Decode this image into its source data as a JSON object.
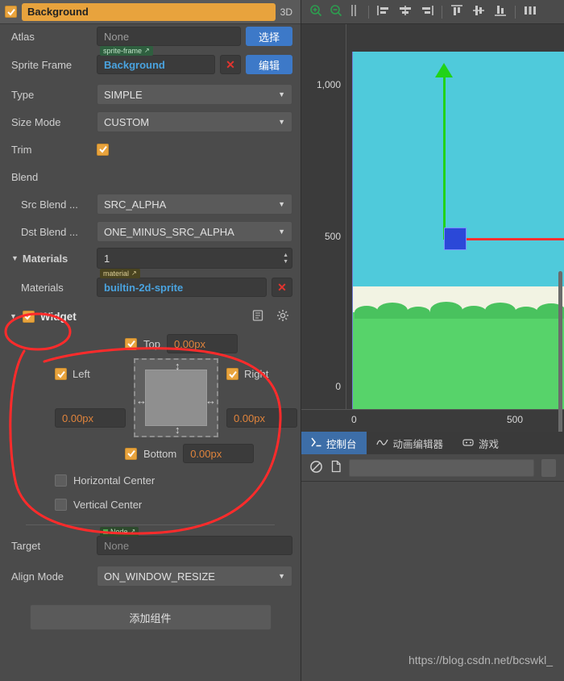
{
  "inspector": {
    "node_enabled": true,
    "node_name": "Background",
    "mode_3d": "3D",
    "properties": [
      {
        "label": "Atlas",
        "type": "asset-select",
        "value": "None",
        "button": "选择"
      },
      {
        "label": "Sprite Frame",
        "type": "asset",
        "tag": "sprite-frame",
        "value": "Background",
        "button": "编辑"
      },
      {
        "label": "Type",
        "type": "select",
        "value": "SIMPLE"
      },
      {
        "label": "Size Mode",
        "type": "select",
        "value": "CUSTOM"
      },
      {
        "label": "Trim",
        "type": "checkbox",
        "checked": true
      },
      {
        "label": "Blend",
        "type": "header"
      },
      {
        "label": "Src Blend ...",
        "type": "select",
        "value": "SRC_ALPHA"
      },
      {
        "label": "Dst Blend ...",
        "type": "select",
        "value": "ONE_MINUS_SRC_ALPHA"
      }
    ],
    "materials": {
      "section_label": "Materials",
      "count": "1",
      "row_label": "Materials",
      "tag": "material",
      "value": "builtin-2d-sprite"
    },
    "widget": {
      "enabled": true,
      "title": "Widget",
      "top": {
        "label": "Top",
        "checked": true,
        "value": "0.00px"
      },
      "left": {
        "label": "Left",
        "checked": true,
        "value": "0.00px"
      },
      "right": {
        "label": "Right",
        "checked": true,
        "value": "0.00px"
      },
      "bottom": {
        "label": "Bottom",
        "checked": true,
        "value": "0.00px"
      },
      "horizontal_center": {
        "label": "Horizontal Center",
        "checked": false
      },
      "vertical_center": {
        "label": "Vertical Center",
        "checked": false
      },
      "target": {
        "label": "Target",
        "tag": "Node",
        "value": "None"
      },
      "align_mode": {
        "label": "Align Mode",
        "value": "ON_WINDOW_RESIZE"
      }
    },
    "add_component_button": "添加组件"
  },
  "scene": {
    "rulers": {
      "left": [
        "1,000",
        "500",
        "0"
      ],
      "bottom": [
        "0",
        "500"
      ]
    }
  },
  "bottom_panel": {
    "tabs": [
      {
        "label": "控制台",
        "icon": "console-icon",
        "active": true
      },
      {
        "label": "动画编辑器",
        "icon": "animation-icon",
        "active": false
      },
      {
        "label": "游戏",
        "icon": "game-icon",
        "active": false
      }
    ],
    "console": {
      "clear_icon": "clear-icon",
      "file_icon": "file-icon",
      "search_placeholder": ""
    }
  },
  "watermark": "https://blog.csdn.net/bcswkl_"
}
